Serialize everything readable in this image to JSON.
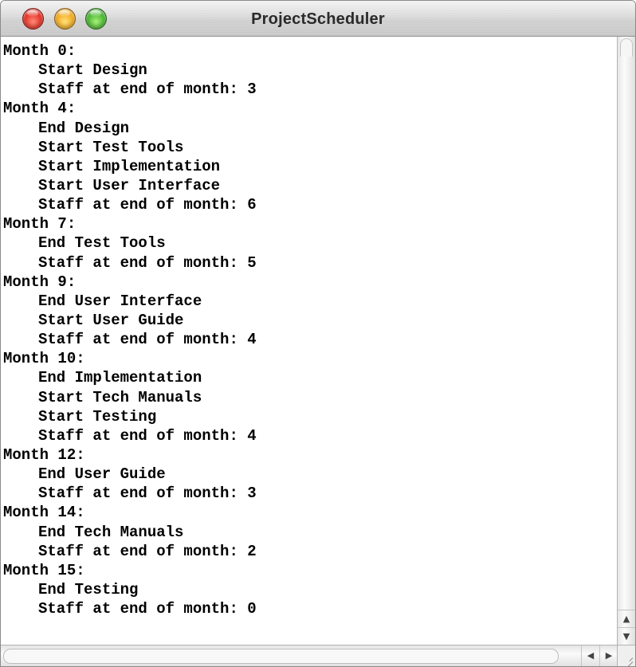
{
  "window": {
    "title": "ProjectScheduler"
  },
  "output": {
    "lines": [
      {
        "text": "Month 0:",
        "indent": false
      },
      {
        "text": "Start Design",
        "indent": true
      },
      {
        "text": "Staff at end of month: 3",
        "indent": true
      },
      {
        "text": "Month 4:",
        "indent": false
      },
      {
        "text": "End Design",
        "indent": true
      },
      {
        "text": "Start Test Tools",
        "indent": true
      },
      {
        "text": "Start Implementation",
        "indent": true
      },
      {
        "text": "Start User Interface",
        "indent": true
      },
      {
        "text": "Staff at end of month: 6",
        "indent": true
      },
      {
        "text": "Month 7:",
        "indent": false
      },
      {
        "text": "End Test Tools",
        "indent": true
      },
      {
        "text": "Staff at end of month: 5",
        "indent": true
      },
      {
        "text": "Month 9:",
        "indent": false
      },
      {
        "text": "End User Interface",
        "indent": true
      },
      {
        "text": "Start User Guide",
        "indent": true
      },
      {
        "text": "Staff at end of month: 4",
        "indent": true
      },
      {
        "text": "Month 10:",
        "indent": false
      },
      {
        "text": "End Implementation",
        "indent": true
      },
      {
        "text": "Start Tech Manuals",
        "indent": true
      },
      {
        "text": "Start Testing",
        "indent": true
      },
      {
        "text": "Staff at end of month: 4",
        "indent": true
      },
      {
        "text": "Month 12:",
        "indent": false
      },
      {
        "text": "End User Guide",
        "indent": true
      },
      {
        "text": "Staff at end of month: 3",
        "indent": true
      },
      {
        "text": "Month 14:",
        "indent": false
      },
      {
        "text": "End Tech Manuals",
        "indent": true
      },
      {
        "text": "Staff at end of month: 2",
        "indent": true
      },
      {
        "text": "Month 15:",
        "indent": false
      },
      {
        "text": "End Testing",
        "indent": true
      },
      {
        "text": "Staff at end of month: 0",
        "indent": true
      }
    ]
  },
  "icons": {
    "close": "close-window-icon",
    "minimize": "minimize-window-icon",
    "zoom": "zoom-window-icon",
    "scroll_up": "arrow-up-icon",
    "scroll_down": "arrow-down-icon",
    "scroll_left": "arrow-left-icon",
    "scroll_right": "arrow-right-icon",
    "resize": "resize-grip-icon"
  },
  "colors": {
    "close": "#e3281c",
    "minimize": "#f2a618",
    "zoom": "#3fb22a",
    "text": "#000000",
    "background": "#ffffff"
  }
}
